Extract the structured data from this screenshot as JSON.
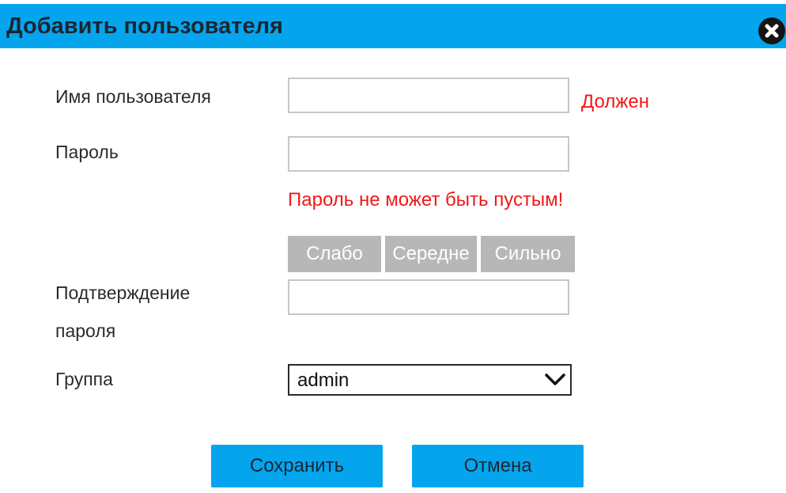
{
  "dialog": {
    "title": "Добавить пользователя",
    "close_icon": "close-icon"
  },
  "form": {
    "username_label": "Имя пользователя",
    "username_value": "",
    "username_required": "Должен",
    "password_label": "Пароль",
    "password_value": "",
    "password_error": "Пароль не может быть пустым!",
    "strength": {
      "weak": "Слабо",
      "medium": "Середне",
      "strong": "Сильно"
    },
    "confirm_label_line1": "Подтверждение",
    "confirm_label_line2": "пароля",
    "confirm_value": "",
    "group_label": "Группа",
    "group_selected": "admin"
  },
  "buttons": {
    "save": "Сохранить",
    "cancel": "Отмена"
  },
  "colors": {
    "accent": "#05a5ee",
    "error": "#f11818",
    "strength_bg": "#b7b7b7"
  }
}
